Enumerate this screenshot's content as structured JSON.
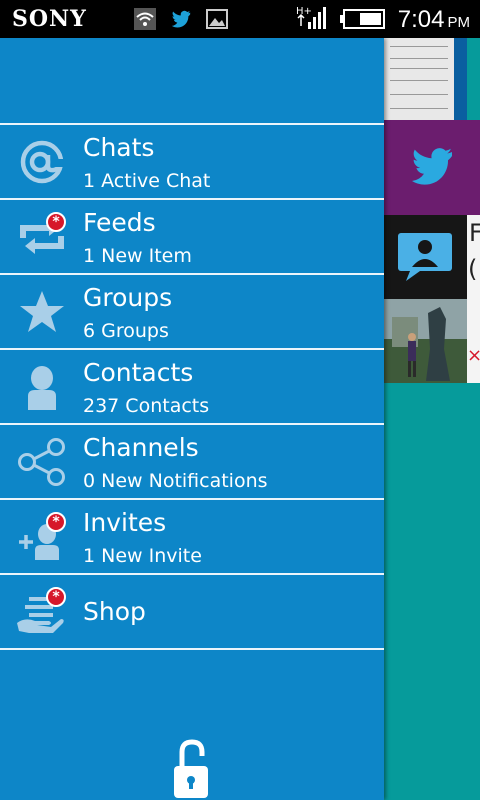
{
  "status_bar": {
    "brand": "SONY",
    "network": "H+",
    "time": "7:04",
    "ampm": "PM"
  },
  "menu": {
    "items": [
      {
        "title": "Chats",
        "subtitle": "1 Active Chat",
        "icon": "at-icon",
        "badge": false
      },
      {
        "title": "Feeds",
        "subtitle": "1 New Item",
        "icon": "repeat-icon",
        "badge": true
      },
      {
        "title": "Groups",
        "subtitle": "6 Groups",
        "icon": "star-icon",
        "badge": false
      },
      {
        "title": "Contacts",
        "subtitle": "237 Contacts",
        "icon": "person-icon",
        "badge": false
      },
      {
        "title": "Channels",
        "subtitle": "0 New Notifications",
        "icon": "share-icon",
        "badge": false
      },
      {
        "title": "Invites",
        "subtitle": "1 New Invite",
        "icon": "add-person-icon",
        "badge": true
      },
      {
        "title": "Shop",
        "icon": "shop-hand-icon",
        "badge": true
      }
    ],
    "badge_symbol": "*"
  },
  "background": {
    "letter": "F",
    "paren": "(",
    "close": "×"
  },
  "colors": {
    "drawer": "#0d86c8",
    "content": "#069b9b",
    "badge": "#d6172a",
    "icon": "#a9cfe8"
  }
}
